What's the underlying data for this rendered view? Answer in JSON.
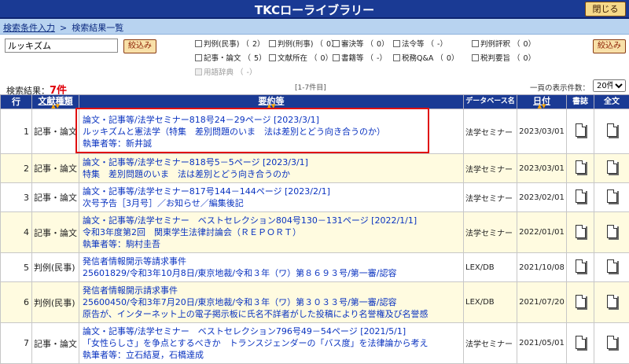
{
  "app": {
    "title": "TKCローライブラリー",
    "close_label": "閉じる"
  },
  "breadcrumb": {
    "link": "検索条件入力",
    "sep": ">",
    "current": "検索結果一覧"
  },
  "filter": {
    "keyword_value": "ルッキズム",
    "narrow_label": "絞込み",
    "narrow_label_right": "絞込み",
    "checkboxes": [
      {
        "label": "判例(民事)",
        "count": "2",
        "disabled": false
      },
      {
        "label": "判例(刑事)",
        "count": "0",
        "disabled": false
      },
      {
        "label": "審決等",
        "count": "0",
        "disabled": false
      },
      {
        "label": "法令等",
        "count": "-",
        "disabled": false
      },
      {
        "label": "判例評釈",
        "count": "0",
        "disabled": false
      },
      {
        "label": "記事・論文",
        "count": "5",
        "disabled": false
      },
      {
        "label": "文献所在",
        "count": "0",
        "disabled": false
      },
      {
        "label": "書籍等",
        "count": "-",
        "disabled": false
      },
      {
        "label": "税務Q&A",
        "count": "0",
        "disabled": false
      },
      {
        "label": "税判要旨",
        "count": "0",
        "disabled": false
      },
      {
        "label": "用語辞典",
        "count": "-",
        "disabled": true
      }
    ]
  },
  "results": {
    "label": "検索結果：",
    "count": "7件",
    "range": "[1-7件目]",
    "perpage_label": "一頁の表示件数：",
    "perpage_value": "20件"
  },
  "table": {
    "headers": {
      "no": "行",
      "type": "文献種類",
      "summary": "要約等",
      "db": "データベース名",
      "date": "日付",
      "book": "書誌",
      "full": "全文"
    },
    "rows": [
      {
        "no": "1",
        "type": "記事・論文",
        "l1": "論文・記事等/法学セミナー818号24－29ページ [2023/3/1]",
        "l2": "ルッキズムと憲法学（特集　差別問題のいま　法は差別とどう向き合うのか）",
        "l3": "執筆者等：新井誠",
        "db": "法学セミナー",
        "date": "2023/03/01"
      },
      {
        "no": "2",
        "type": "記事・論文",
        "l1": "論文・記事等/法学セミナー818号5－5ページ [2023/3/1]",
        "l2": "特集　差別問題のいま　法は差別とどう向き合うのか",
        "l3": "",
        "db": "法学セミナー",
        "date": "2023/03/01"
      },
      {
        "no": "3",
        "type": "記事・論文",
        "l1": "論文・記事等/法学セミナー817号144－144ページ [2023/2/1]",
        "l2": "次号予告［3月号］／お知らせ／編集後記",
        "l3": "",
        "db": "法学セミナー",
        "date": "2023/02/01"
      },
      {
        "no": "4",
        "type": "記事・論文",
        "l1": "論文・記事等/法学セミナー　ベストセレクション804号130－131ページ [2022/1/1]",
        "l2": "令和3年度第2回　関東学生法律討論会（ＲＥＰＯＲＴ）",
        "l3": "執筆者等：駒村圭吾",
        "db": "法学セミナー",
        "date": "2022/01/01"
      },
      {
        "no": "5",
        "type": "判例(民事)",
        "l1": "発信者情報開示等請求事件",
        "l2": "25601829/令和3年10月8日/東京地裁/令和３年（ワ）第８６９３号/第一審/認容",
        "l3": "",
        "db": "LEX/DB",
        "date": "2021/10/08"
      },
      {
        "no": "6",
        "type": "判例(民事)",
        "l1": "発信者情報開示請求事件",
        "l2": "25600450/令和3年7月20日/東京地裁/令和３年（ワ）第３０３３号/第一審/認容",
        "l3": "原告が、インターネット上の電子掲示板に氏名不詳者がした投稿により名誉権及び名誉感",
        "db": "LEX/DB",
        "date": "2021/07/20"
      },
      {
        "no": "7",
        "type": "記事・論文",
        "l1": "論文・記事等/法学セミナー　ベストセレクション796号49－54ページ [2021/5/1]",
        "l2": "「女性らしさ」を争点とするべきか　トランスジェンダーの「バス度」を法律論から考え",
        "l3": "執筆者等：立石結夏，石橋達成",
        "db": "法学セミナー",
        "date": "2021/05/01"
      }
    ]
  }
}
